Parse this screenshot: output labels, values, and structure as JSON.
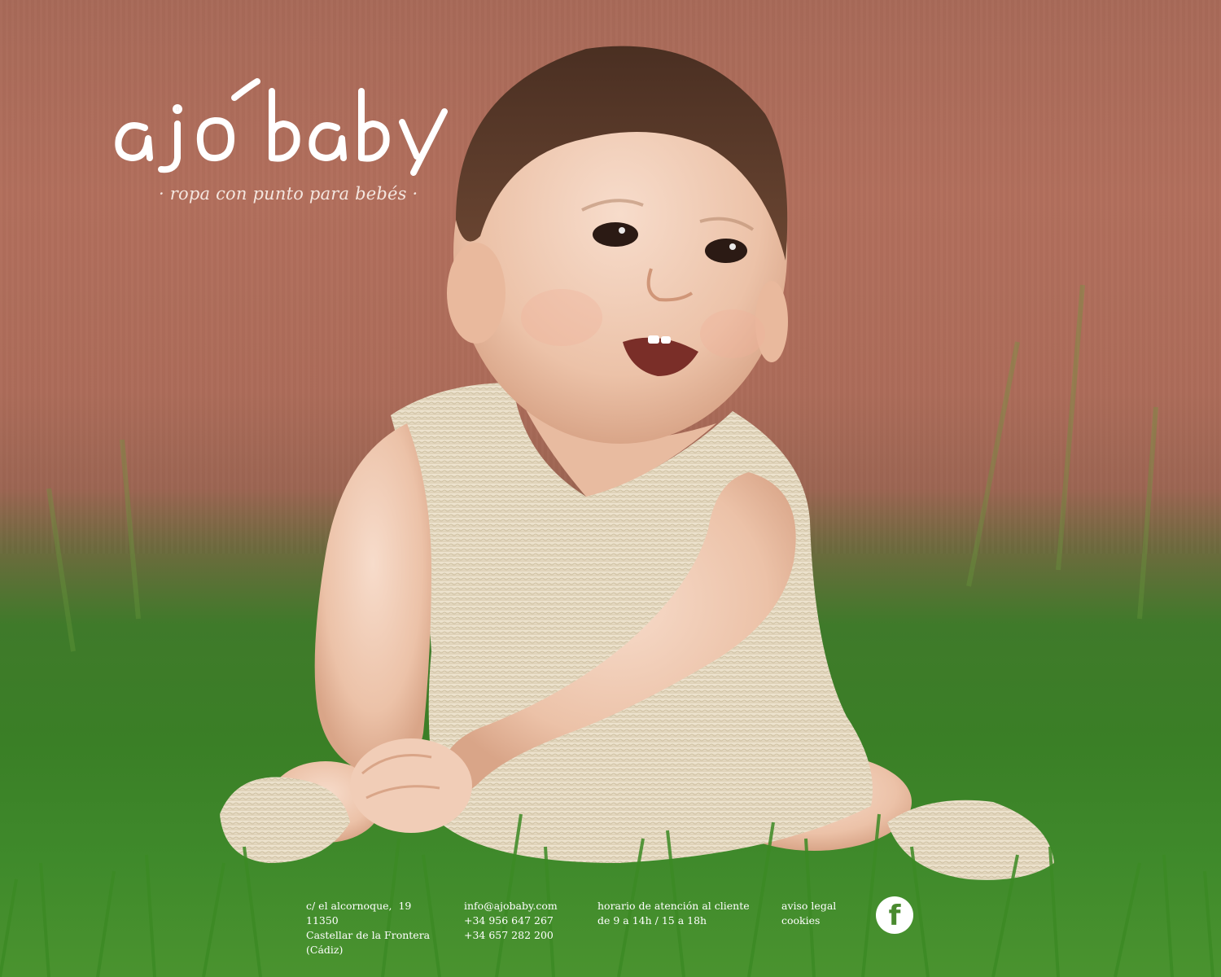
{
  "brand": {
    "name": "ajobaby",
    "tagline": "· ropa con punto para bebés ·"
  },
  "hero": {
    "image": "baby-in-knit-romper-on-grass"
  },
  "footer": {
    "address": [
      "c/ el alcornoque,  19",
      "11350",
      "Castellar de la Frontera",
      "(Cádiz)"
    ],
    "contact": {
      "email": "info@ajobaby.com",
      "phone1": "+34 956 647 267",
      "phone2": "+34 657 282 200"
    },
    "hours": {
      "label": "horario de atención al cliente",
      "value": "de 9 a 14h / 15 a 18h"
    },
    "legal": {
      "aviso": "aviso legal",
      "cookies": "cookies"
    },
    "social": {
      "facebook_glyph": "f",
      "icon": "facebook-icon"
    }
  },
  "colors": {
    "wall": "#ad6c59",
    "grass": "#3f8a2b",
    "text": "#ffffff"
  }
}
